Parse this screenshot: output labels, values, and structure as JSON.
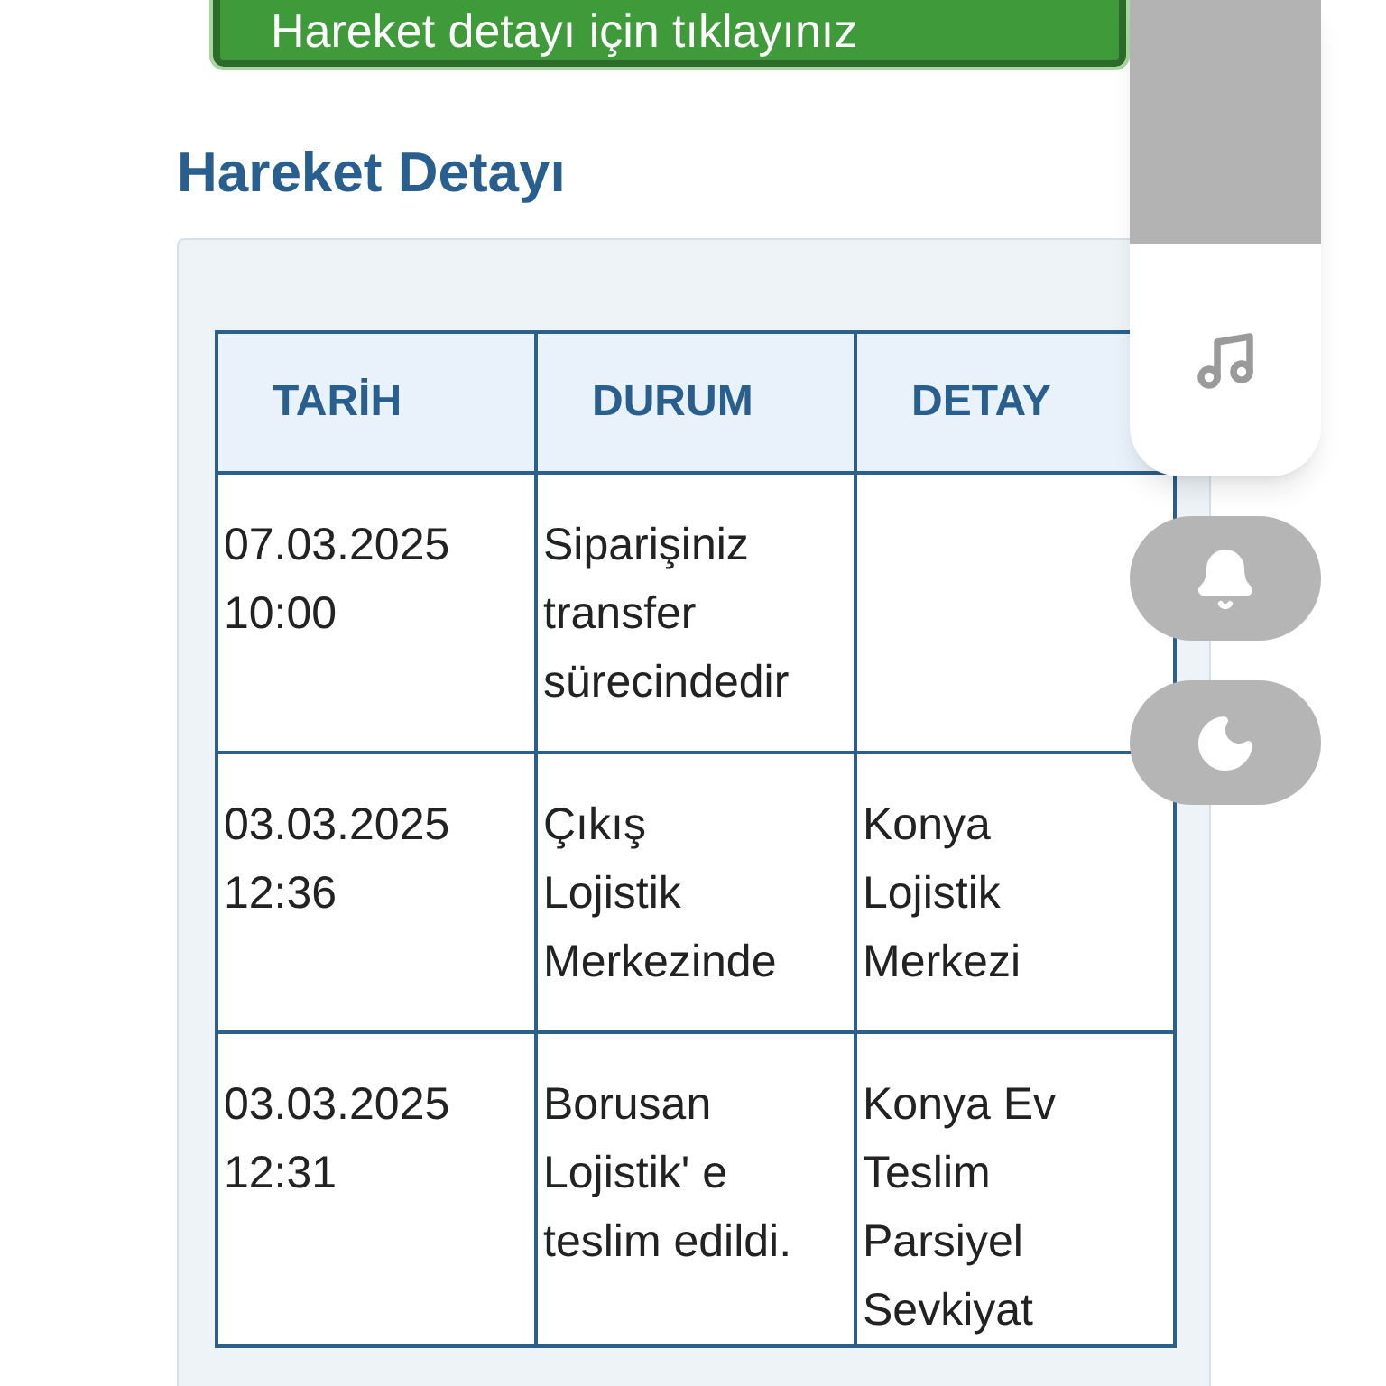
{
  "top_button": {
    "label": "Hareket detayı için tıklayınız"
  },
  "section_title": "Hareket Detayı",
  "table": {
    "columns": [
      "TARİH",
      "DURUM",
      "DETAY"
    ],
    "rows": [
      {
        "cells": [
          "07.03.2025 10:00",
          "Siparişiniz transfer sürecindedir",
          ""
        ]
      },
      {
        "cells": [
          "03.03.2025 12:36",
          "Çıkış Lojistik Merkezinde",
          "Konya Lojistik Merkezi"
        ]
      },
      {
        "cells": [
          "03.03.2025 12:31",
          "Borusan Lojistik' e teslim edildi.",
          "Konya Ev Teslim Parsiyel Sevkiyat"
        ]
      }
    ]
  },
  "side_panel": {
    "buttons": [
      {
        "kind": "music"
      },
      {
        "kind": "bell"
      },
      {
        "kind": "moon"
      }
    ]
  }
}
